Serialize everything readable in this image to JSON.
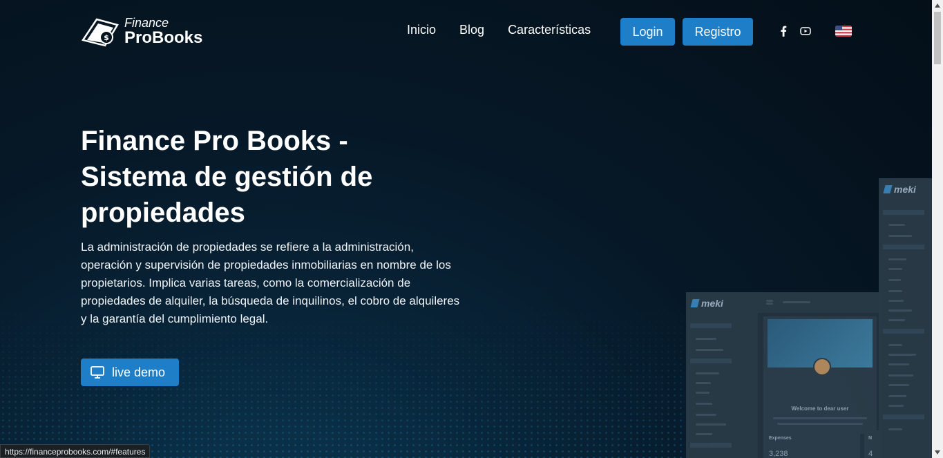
{
  "header": {
    "logo_top": "Finance",
    "logo_bottom": "ProBooks",
    "nav": [
      "Inicio",
      "Blog",
      "Características"
    ],
    "login_label": "Login",
    "register_label": "Registro",
    "social": [
      "facebook-icon",
      "youtube-icon"
    ],
    "language_flag": "us-flag-icon"
  },
  "hero": {
    "title": "Finance Pro Books - Sistema de gestión de propiedades",
    "description": "La administración de propiedades se refiere a la administración, operación y supervisión de propiedades inmobiliarias en nombre de los propietarios. Implica varias tareas, como la comercialización de propiedades de alquiler, la búsqueda de inquilinos, el cobro de alquileres y la garantía del cumplimiento legal.",
    "demo_label": "live demo",
    "demo_icon": "monitor-icon"
  },
  "mockup": {
    "brand": "meki",
    "welcome": "Welcome to dear user",
    "stat_label": "Expenses",
    "stat_value": "3,238",
    "stat2_label": "N",
    "stat2_value": "4"
  },
  "status_bar": {
    "url": "https://financeprobooks.com/#features"
  },
  "colors": {
    "accent": "#1e7fc8",
    "background": "#06141f"
  }
}
